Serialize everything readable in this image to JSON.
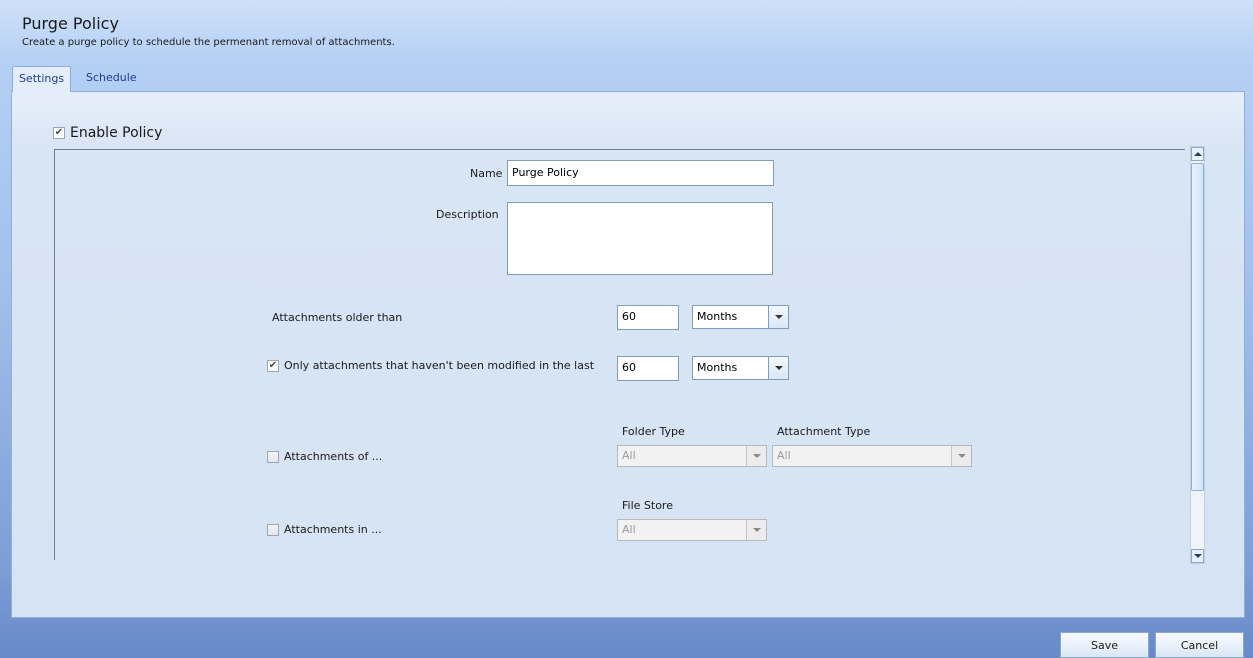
{
  "header": {
    "title": "Purge Policy",
    "subtitle": "Create a purge policy to schedule the permenant removal of attachments."
  },
  "tabs": [
    {
      "label": "Settings",
      "active": true
    },
    {
      "label": "Schedule",
      "active": false
    }
  ],
  "enable_policy": {
    "label": "Enable Policy",
    "checked": true
  },
  "form": {
    "name_label": "Name",
    "name_value": "Purge Policy",
    "description_label": "Description",
    "description_value": "",
    "older_than_label": "Attachments older than",
    "older_than_value": "60",
    "older_than_unit": "Months",
    "not_modified_label": "Only attachments that haven't been modified in the last",
    "not_modified_checked": true,
    "not_modified_value": "60",
    "not_modified_unit": "Months",
    "attachments_of_label": "Attachments of ...",
    "attachments_of_checked": false,
    "folder_type_label": "Folder Type",
    "folder_type_value": "All",
    "attachment_type_label": "Attachment Type",
    "attachment_type_value": "All",
    "attachments_in_label": "Attachments in ...",
    "attachments_in_checked": false,
    "file_store_label": "File Store",
    "file_store_value": "All"
  },
  "footer": {
    "save_label": "Save",
    "cancel_label": "Cancel"
  },
  "icons": {
    "checkmark": "✔"
  }
}
